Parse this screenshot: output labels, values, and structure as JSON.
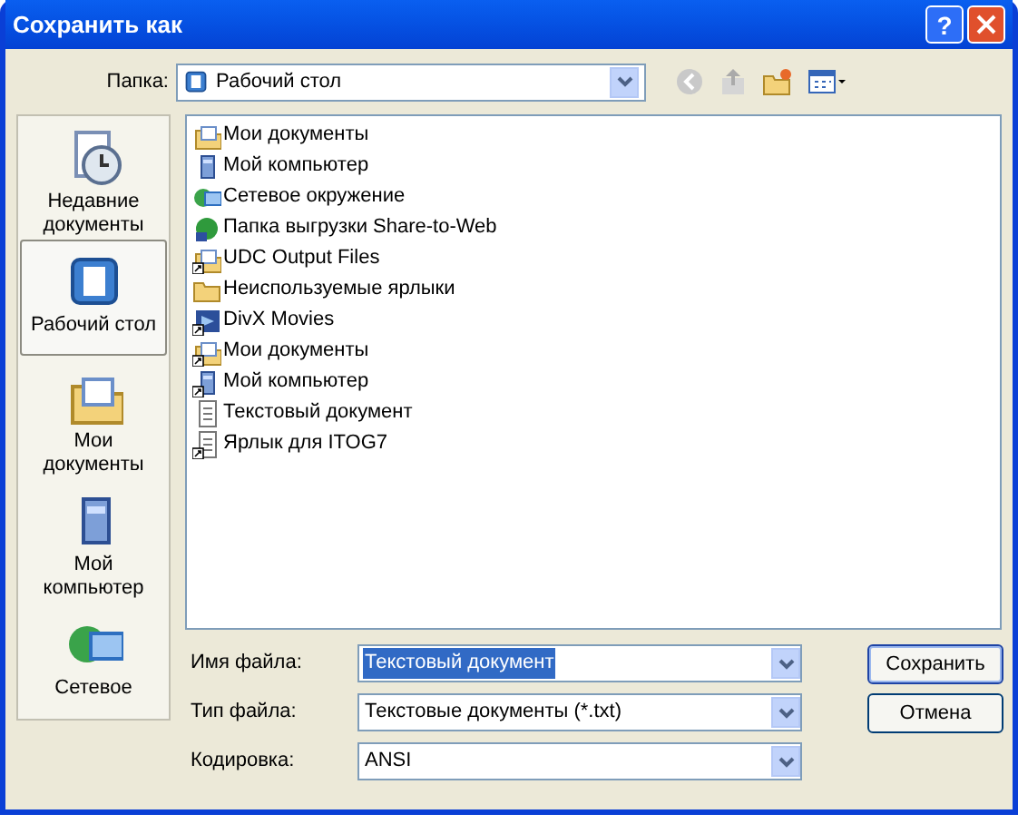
{
  "window": {
    "title": "Сохранить как",
    "help_button": "?"
  },
  "folder": {
    "label": "Папка:",
    "value": "Рабочий стол"
  },
  "places": [
    {
      "label": "Недавние документы",
      "kind": "recent",
      "selected": false
    },
    {
      "label": "Рабочий стол",
      "kind": "desktop",
      "selected": true
    },
    {
      "label": "Мои документы",
      "kind": "documents",
      "selected": false
    },
    {
      "label": "Мой компьютер",
      "kind": "computer",
      "selected": false
    },
    {
      "label": "Сетевое",
      "kind": "network",
      "selected": false
    }
  ],
  "files": [
    {
      "name": "Мои документы",
      "kind": "documents",
      "shortcut": false
    },
    {
      "name": "Мой компьютер",
      "kind": "computer",
      "shortcut": false
    },
    {
      "name": "Сетевое окружение",
      "kind": "network",
      "shortcut": false
    },
    {
      "name": "Папка выгрузки Share-to-Web",
      "kind": "web",
      "shortcut": false
    },
    {
      "name": "UDC Output Files",
      "kind": "documents",
      "shortcut": true
    },
    {
      "name": "Неиспользуемые ярлыки",
      "kind": "folder",
      "shortcut": false
    },
    {
      "name": "DivX Movies",
      "kind": "movie",
      "shortcut": true
    },
    {
      "name": "Мои документы",
      "kind": "documents",
      "shortcut": true
    },
    {
      "name": "Мой компьютер",
      "kind": "computer",
      "shortcut": true
    },
    {
      "name": "Текстовый документ",
      "kind": "text",
      "shortcut": false
    },
    {
      "name": "Ярлык для ITOG7",
      "kind": "text",
      "shortcut": true
    }
  ],
  "fields": [
    {
      "label": "Имя файла:",
      "value": "Текстовый документ",
      "selected": true
    },
    {
      "label": "Тип файла:",
      "value": "Текстовые документы (*.txt)",
      "selected": false
    },
    {
      "label": "Кодировка:",
      "value": "ANSI",
      "selected": false
    }
  ],
  "buttons": [
    "Сохранить",
    "Отмена"
  ]
}
